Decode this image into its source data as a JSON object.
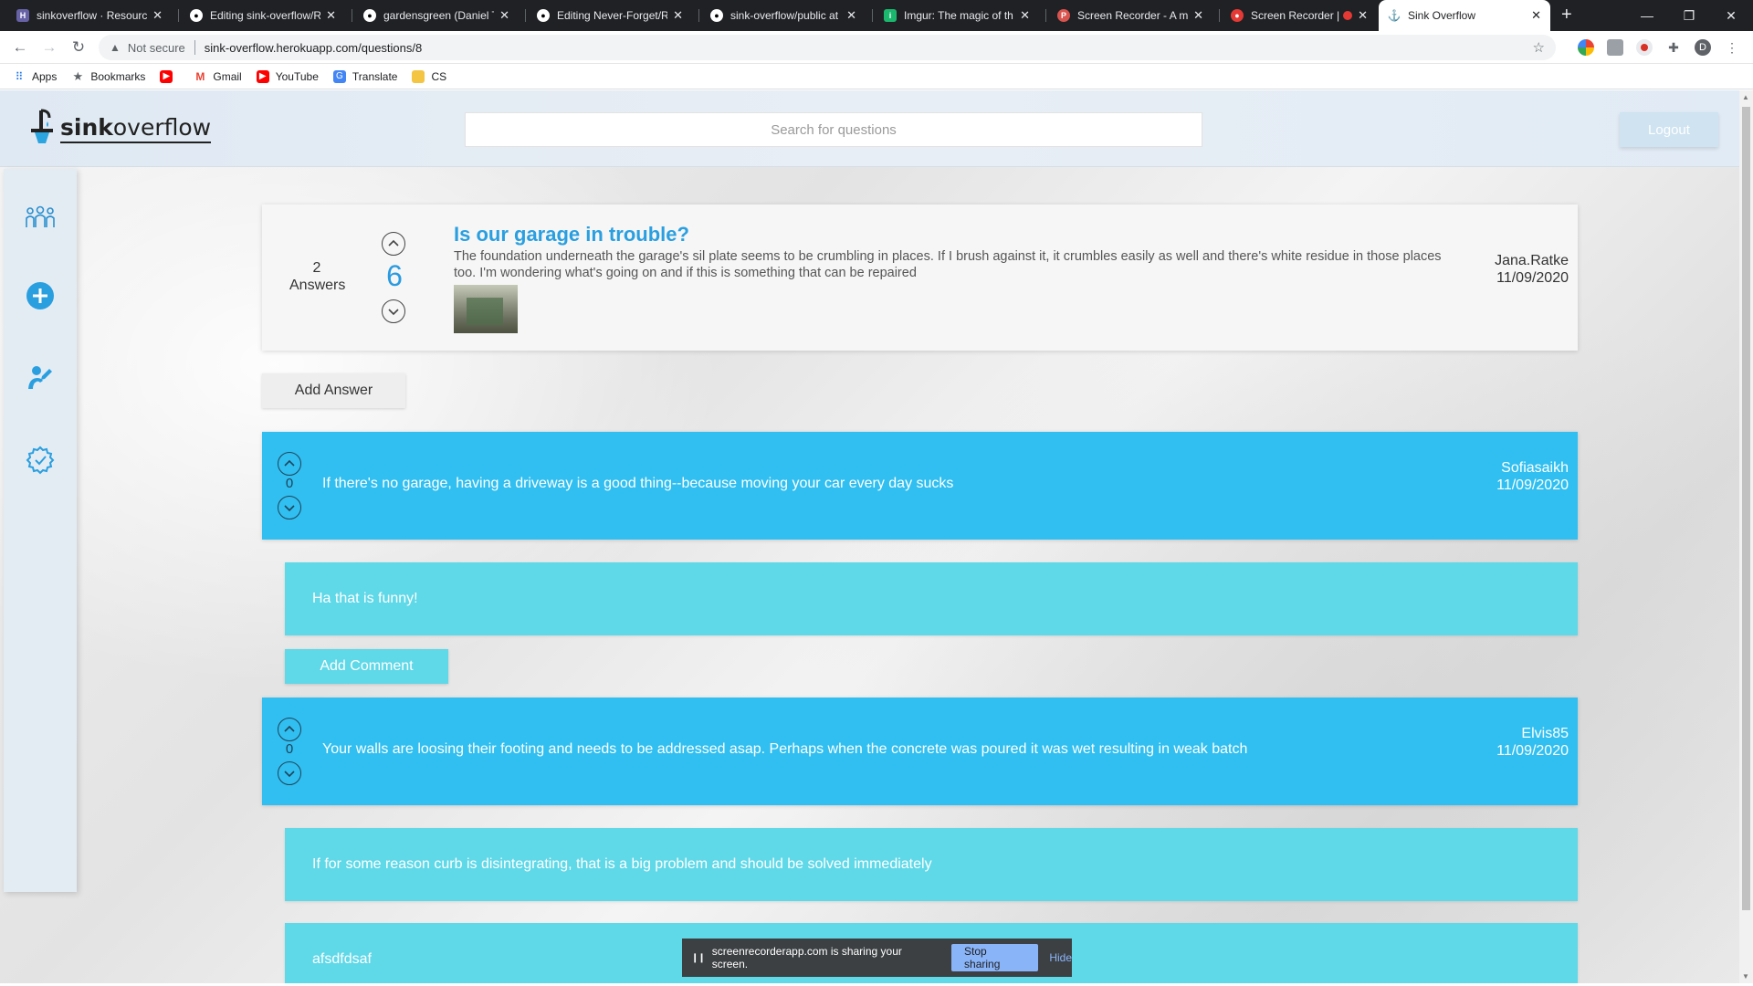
{
  "browser": {
    "tabs": [
      {
        "label": "sinkoverflow · Resource",
        "favicon": "heroku-icon"
      },
      {
        "label": "Editing sink-overflow/R",
        "favicon": "github-icon"
      },
      {
        "label": "gardensgreen (Daniel T",
        "favicon": "github-icon"
      },
      {
        "label": "Editing Never-Forget/R",
        "favicon": "github-icon"
      },
      {
        "label": "sink-overflow/public at",
        "favicon": "github-icon"
      },
      {
        "label": "Imgur: The magic of th",
        "favicon": "imgur-icon"
      },
      {
        "label": "Screen Recorder - A mi",
        "favicon": "screenrecorder-icon"
      },
      {
        "label": "Screen Recorder |",
        "favicon": "record-icon"
      },
      {
        "label": "Sink Overflow",
        "favicon": "sinkoverflow-icon",
        "active": true
      }
    ],
    "address": {
      "security": "Not secure",
      "url": "sink-overflow.herokuapp.com/questions/8"
    },
    "bookmarks": [
      {
        "label": "Apps",
        "icon": "apps-grid-icon"
      },
      {
        "label": "Bookmarks",
        "icon": "star-icon"
      },
      {
        "label": "",
        "icon": "youtube-icon"
      },
      {
        "label": "Gmail",
        "icon": "gmail-icon"
      },
      {
        "label": "YouTube",
        "icon": "youtube-icon"
      },
      {
        "label": "Translate",
        "icon": "translate-icon"
      },
      {
        "label": "CS",
        "icon": "folder-icon"
      }
    ],
    "profile_initial": "D"
  },
  "header": {
    "logo_bold": "sink",
    "logo_rest": "overflow",
    "search_placeholder": "Search for questions",
    "logout_label": "Logout"
  },
  "sidebar": {
    "icons": [
      "community-icon",
      "add-question-icon",
      "user-icon",
      "settings-badge-icon"
    ]
  },
  "question": {
    "answers_count": "2",
    "answers_label": "Answers",
    "score": "6",
    "title": "Is our garage in trouble?",
    "body": "The foundation underneath the garage's sil plate seems to be crumbling in places. If I brush against it, it crumbles easily as well and there's white residue in those places too. I'm wondering what's going on and if this is something that can be repaired",
    "author": "Jana.Ratke",
    "date": "11/09/2020"
  },
  "add_answer_label": "Add Answer",
  "answers": [
    {
      "score": "0",
      "text": "If there's no garage, having a driveway is a good thing--because moving your car every day sucks",
      "author": "Sofiasaikh",
      "date": "11/09/2020",
      "comments": [
        "Ha that is funny!"
      ],
      "add_comment_label": "Add Comment"
    },
    {
      "score": "0",
      "text": "Your walls are loosing their footing and needs to be addressed asap. Perhaps when the concrete was poured it was wet resulting in weak batch",
      "author": "Elvis85",
      "date": "11/09/2020",
      "comments": [
        "If for some reason curb is disintegrating, that is a big problem and should be solved immediately",
        "afsdfdsaf"
      ]
    }
  ],
  "share_notice": {
    "text": "screenrecorderapp.com is sharing your screen.",
    "stop_label": "Stop sharing",
    "hide_label": "Hide"
  },
  "colors": {
    "answer_bg": "#30bff0",
    "comment_bg": "#5fd8e8",
    "title_blue": "#2a9fe0"
  }
}
